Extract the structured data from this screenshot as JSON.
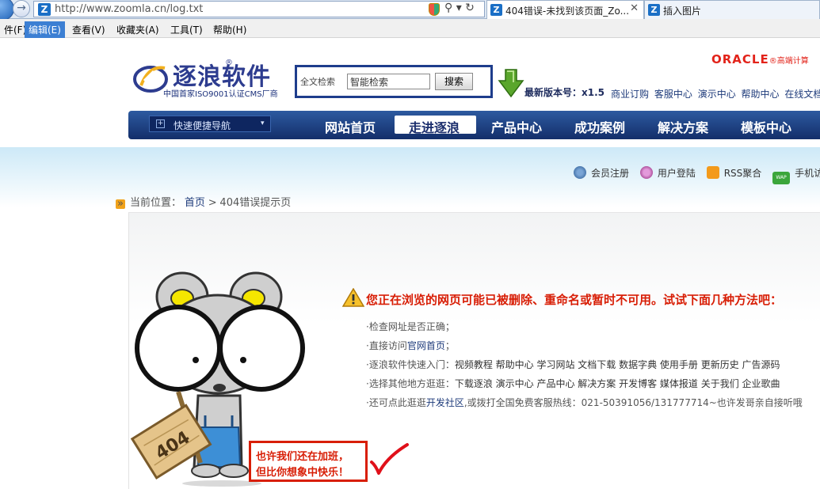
{
  "browser": {
    "url": "http://www.zoomla.cn/log.txt",
    "favicon_letter": "Z",
    "forward_glyph": "→",
    "addr_icons": "⚲ ▾ ↻",
    "tabs": [
      {
        "title": "404错误-未找到该页面_Zo...",
        "close": "✕",
        "active": true
      },
      {
        "title": "插入图片",
        "close": "",
        "active": false
      }
    ],
    "menu": [
      "件(F)",
      "编辑(E)",
      "查看(V)",
      "收藏夹(A)",
      "工具(T)",
      "帮助(H)"
    ]
  },
  "site": {
    "logo_text": "逐浪软件",
    "logo_reg": "®",
    "logo_tagline": "中国首家ISO9001认证CMS厂商",
    "search": {
      "label": "全文检索",
      "value": "智能检索",
      "button": "搜索"
    },
    "version": "最新版本号：x1.5",
    "top_links": [
      "商业订购",
      "客服中心",
      "演示中心",
      "帮助中心",
      "在线文档"
    ],
    "oracle": {
      "word": "ORACLE",
      "sub": "®高端计算"
    },
    "quick_nav": {
      "plus": "+",
      "label": "快速便捷导航",
      "caret": "▾"
    },
    "main_nav": [
      "网站首页",
      "走进逐浪",
      "产品中心",
      "成功案例",
      "解决方案",
      "模板中心"
    ],
    "main_nav_active": 1,
    "util_links": {
      "register": "会员注册",
      "login": "用户登陆",
      "rss": "RSS聚合",
      "mobile": "手机访",
      "wap_badge": "WAP"
    },
    "breadcrumb": {
      "icon": "»",
      "label": "当前位置：",
      "home": "首页",
      "sep": ">",
      "current": "404错误提示页"
    }
  },
  "error": {
    "badge": "404",
    "headline": "您正在浏览的网页可能已被删除、重命名或暂时不可用。试试下面几种方法吧：",
    "tips": [
      {
        "prefix": "·检查网址是否正确；",
        "links": ""
      },
      {
        "prefix": "·直接访问",
        "links": "官网首页",
        "suffix": "；"
      },
      {
        "prefix": "·逐浪软件快速入门：",
        "links": "视频教程 帮助中心 学习网站 文档下载 数据字典 使用手册 更新历史 广告源码"
      },
      {
        "prefix": "·选择其他地方逛逛：",
        "links": "下载逐浪 演示中心 产品中心 解决方案 开发博客 媒体报道 关于我们 企业歌曲"
      },
      {
        "prefix": "·还可点此逛逛",
        "links": "开发社区",
        "suffix": ",或拨打全国免费客服热线：021-50391056/131777714~也许发哥亲自接听哦"
      }
    ],
    "slogan": [
      "也许我们还在加班，",
      "但比你想象中快乐！"
    ]
  },
  "colors": {
    "nav_blue": "#1e3d8c",
    "error_red": "#d81e06",
    "link_blue": "#1d3a7a"
  }
}
